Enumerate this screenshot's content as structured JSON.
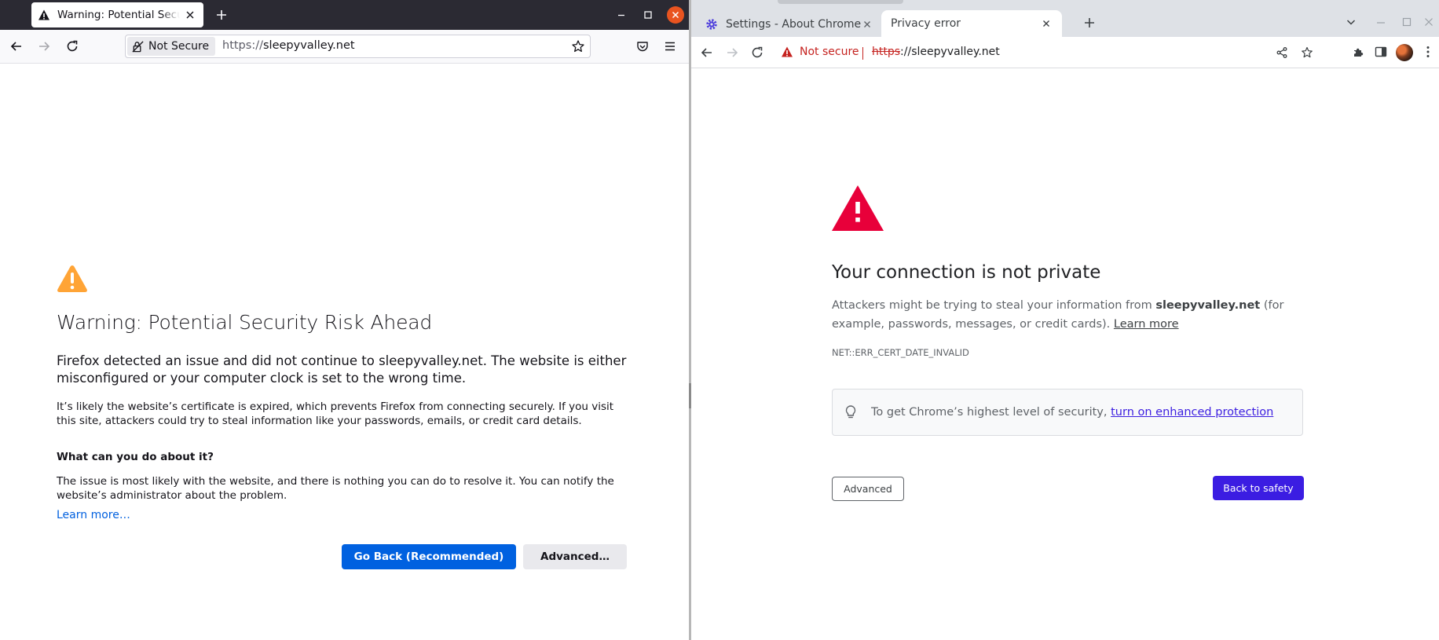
{
  "colors": {
    "firefox_chrome_dark": "#2b2a33",
    "firefox_primary": "#0061e0",
    "firefox_link": "#0060df",
    "firefox_warning": "#ffa436",
    "ubuntu_close": "#e95420",
    "chrome_error_red": "#e8003a",
    "chrome_not_secure_red": "#c5221f",
    "chrome_primary": "#3b1de2"
  },
  "firefox": {
    "tab": {
      "title": "Warning: Potential Security Risk Ahead",
      "icon": "warning-icon"
    },
    "urlbar": {
      "identity_label": "Not Secure",
      "url_scheme": "https://",
      "url_host": "sleepyvalley.net"
    },
    "page": {
      "title": "Warning: Potential Security Risk Ahead",
      "intro": "Firefox detected an issue and did not continue to sleepyvalley.net. The website is either misconfigured or your computer clock is set to the wrong time.",
      "explanation": "It’s likely the website’s certificate is expired, which prevents Firefox from connecting securely. If you visit this site, attackers could try to steal information like your passwords, emails, or credit card details.",
      "what_heading": "What can you do about it?",
      "issue": "The issue is most likely with the website, and there is nothing you can do to resolve it. You can notify the website’s administrator about the problem.",
      "learn_more": "Learn more…",
      "go_back_label": "Go Back (Recommended)",
      "advanced_label": "Advanced…"
    }
  },
  "chrome": {
    "tabs": [
      {
        "title": "Settings - About Chrome",
        "icon": "gear-icon"
      },
      {
        "title": "Privacy error",
        "icon": "none"
      }
    ],
    "omnibox": {
      "security_label": "Not secure",
      "url_scheme": "https",
      "url_rest": "://sleepyvalley.net"
    },
    "page": {
      "heading": "Your connection is not private",
      "desc_before": "Attackers might be trying to steal your information from ",
      "desc_host": "sleepyvalley.net",
      "desc_after": " (for example, passwords, messages, or credit cards). ",
      "desc_learn_more": "Learn more",
      "error_code": "NET::ERR_CERT_DATE_INVALID",
      "enhanced_text": "To get Chrome’s highest level of security, ",
      "enhanced_link": "turn on enhanced protection",
      "advanced_label": "Advanced",
      "back_to_safety_label": "Back to safety"
    }
  }
}
